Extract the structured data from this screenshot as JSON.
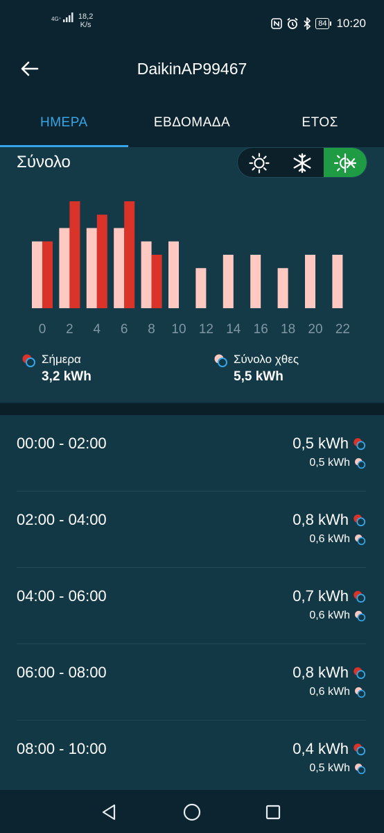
{
  "status_bar": {
    "network": "4G⁺",
    "speed_value": "18,2",
    "speed_unit": "K/s",
    "battery": "84",
    "time": "10:20"
  },
  "app_bar": {
    "title": "DaikinAP99467"
  },
  "tabs": [
    {
      "label": "ΗΜΕΡΑ",
      "active": true
    },
    {
      "label": "ΕΒΔΟΜΑΔΑ",
      "active": false
    },
    {
      "label": "ΕΤΟΣ",
      "active": false
    }
  ],
  "summary": {
    "title": "Σύνολο",
    "modes": [
      {
        "name": "sun-icon",
        "active": false
      },
      {
        "name": "snowflake-icon",
        "active": false
      },
      {
        "name": "auto-mode-icon",
        "active": true
      }
    ]
  },
  "chart_data": {
    "type": "bar",
    "categories": [
      "0",
      "2",
      "4",
      "6",
      "8",
      "10",
      "12",
      "14",
      "16",
      "18",
      "20",
      "22"
    ],
    "series": [
      {
        "name": "Σύνολο χθες",
        "color": "#ffc9c2",
        "values": [
          0.5,
          0.6,
          0.6,
          0.6,
          0.5,
          0.5,
          0.3,
          0.4,
          0.4,
          0.3,
          0.4,
          0.4
        ]
      },
      {
        "name": "Σήμερα",
        "color": "#d9332a",
        "values": [
          0.5,
          0.8,
          0.7,
          0.8,
          0.4,
          null,
          null,
          null,
          null,
          null,
          null,
          null
        ]
      }
    ],
    "ylim": [
      0,
      0.8
    ],
    "grid": false
  },
  "legend": {
    "today_label": "Σήμερα",
    "today_value": "3,2 kWh",
    "yesterday_label": "Σύνολο χθες",
    "yesterday_value": "5,5 kWh"
  },
  "rows": [
    {
      "time": "00:00 - 02:00",
      "today": "0,5 kWh",
      "yesterday": "0,5 kWh"
    },
    {
      "time": "02:00 - 04:00",
      "today": "0,8 kWh",
      "yesterday": "0,6 kWh"
    },
    {
      "time": "04:00 - 06:00",
      "today": "0,7 kWh",
      "yesterday": "0,6 kWh"
    },
    {
      "time": "06:00 - 08:00",
      "today": "0,8 kWh",
      "yesterday": "0,6 kWh"
    },
    {
      "time": "08:00 - 10:00",
      "today": "0,4 kWh",
      "yesterday": "0,5 kWh"
    }
  ]
}
